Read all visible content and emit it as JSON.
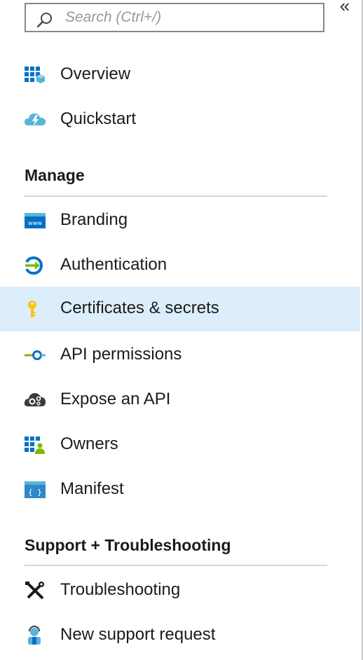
{
  "search": {
    "placeholder": "Search (Ctrl+/)"
  },
  "collapse_glyph": "«",
  "nav_top": [
    {
      "label": "Overview",
      "icon": "overview-grid-icon"
    },
    {
      "label": "Quickstart",
      "icon": "quickstart-cloud-icon"
    }
  ],
  "sections": [
    {
      "title": "Manage",
      "items": [
        {
          "label": "Branding",
          "icon": "www-icon"
        },
        {
          "label": "Authentication",
          "icon": "authentication-icon"
        },
        {
          "label": "Certificates & secrets",
          "icon": "key-icon",
          "selected": true
        },
        {
          "label": "API permissions",
          "icon": "api-permissions-icon"
        },
        {
          "label": "Expose an API",
          "icon": "cloud-gear-icon"
        },
        {
          "label": "Owners",
          "icon": "owners-icon"
        },
        {
          "label": "Manifest",
          "icon": "manifest-braces-icon"
        }
      ]
    },
    {
      "title": "Support + Troubleshooting",
      "items": [
        {
          "label": "Troubleshooting",
          "icon": "wrench-screwdriver-icon"
        },
        {
          "label": "New support request",
          "icon": "support-person-icon"
        }
      ]
    }
  ],
  "colors": {
    "selected_bg": "#dceefb",
    "azure_blue": "#0072c6",
    "key_yellow": "#f8c617",
    "green": "#7fba00"
  }
}
